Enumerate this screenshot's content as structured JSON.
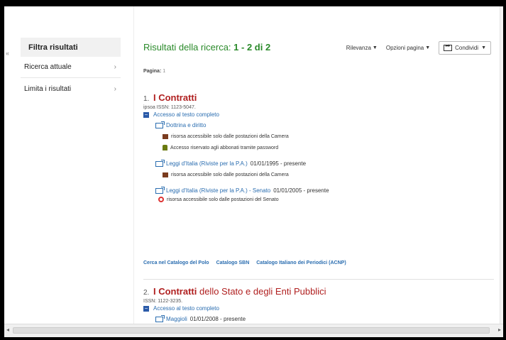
{
  "sidebar": {
    "collapse_glyph": "«",
    "header": "Filtra risultati",
    "items": [
      {
        "label": "Ricerca attuale",
        "chevron": "›"
      },
      {
        "label": "Limita i risultati",
        "chevron": "›"
      }
    ]
  },
  "header": {
    "title_prefix": "Risultati della ricerca:",
    "title_count": "1 - 2 di 2",
    "sort_label": "Rilevanza",
    "options_label": "Opzioni pagina",
    "share_label": "Condividi"
  },
  "pager": {
    "label": "Pagina:",
    "value": "1"
  },
  "results": [
    {
      "num": "1.",
      "title_highlight": "I Contratti",
      "title_rest": "",
      "issn": "ipsoa  ISSN: 1123-5047.",
      "access_label": "Accesso al testo completo",
      "sources": [
        {
          "name": "Dottrina e diritto",
          "dates": "",
          "notes": [
            {
              "icon": "building-icon",
              "text": "risorsa accessibile solo dalle postazioni della Camera"
            },
            {
              "icon": "lock-icon",
              "text": "Accesso riservato agli abbonati tramite password"
            }
          ]
        },
        {
          "name": "Leggi d'Italia (Riviste per la P.A.)",
          "dates": "01/01/1995 - presente",
          "notes": [
            {
              "icon": "building-icon",
              "text": "risorsa accessibile solo dalle postazioni della Camera"
            }
          ]
        },
        {
          "name": "Leggi d'Italia (Riviste per la P.A.) - Senato",
          "dates": "01/01/2005 - presente",
          "notes": [
            {
              "icon": "senate-icon",
              "text": "risorsa accessibile solo dalle postazioni del Senato"
            }
          ]
        }
      ]
    },
    {
      "num": "2.",
      "title_highlight": "I Contratti",
      "title_rest": " dello Stato e degli Enti Pubblici",
      "issn": "ISSN: 1122-3235.",
      "access_label": "Accesso al testo completo",
      "sources": [
        {
          "name": "Maggioli",
          "dates": "01/01/2008 - presente",
          "notes": []
        }
      ]
    }
  ],
  "catalog_links": [
    "Cerca nel Catalogo del Polo",
    "Catalogo SBN",
    "Catalogo Italiano dei Periodici (ACNP)"
  ],
  "colors": {
    "title_green": "#2a8a2a",
    "result_red": "#b02020",
    "link_blue": "#2a6db0"
  }
}
